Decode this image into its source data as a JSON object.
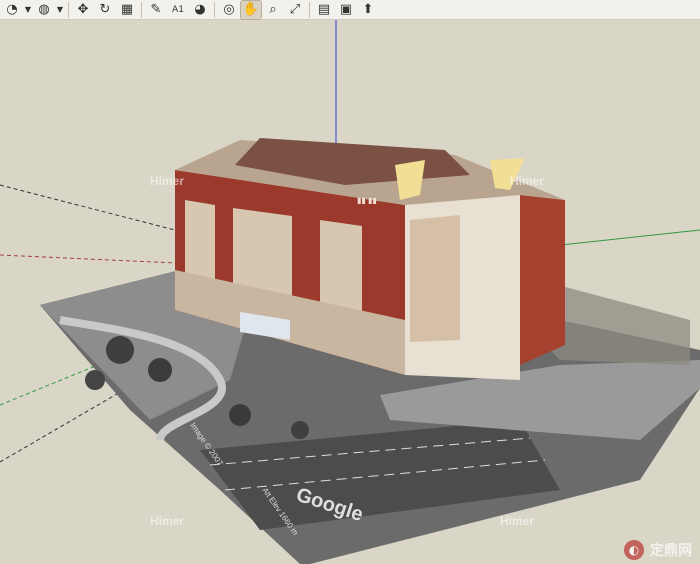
{
  "toolbar": {
    "items": [
      {
        "name": "arc-icon",
        "glyph": "◔"
      },
      {
        "name": "offset-icon",
        "glyph": "◍"
      },
      {
        "name": "move-icon",
        "glyph": "✥"
      },
      {
        "name": "rotate-icon",
        "glyph": "↻"
      },
      {
        "name": "push-pull-icon",
        "glyph": "▦"
      },
      {
        "name": "tape-measure-icon",
        "glyph": "✎"
      },
      {
        "name": "text-icon",
        "glyph": "A1"
      },
      {
        "name": "paint-bucket-icon",
        "glyph": "◕"
      },
      {
        "name": "orbit-icon",
        "glyph": "◎"
      },
      {
        "name": "pan-icon",
        "glyph": "✋"
      },
      {
        "name": "zoom-icon",
        "glyph": "⌕"
      },
      {
        "name": "zoom-extents-icon",
        "glyph": "⤢"
      },
      {
        "name": "components-icon",
        "glyph": "▤"
      },
      {
        "name": "materials-icon",
        "glyph": "▣"
      },
      {
        "name": "get-models-icon",
        "glyph": "⬆"
      }
    ]
  },
  "viewport": {
    "watermarks": [
      "Himer",
      "Himer",
      "Himer",
      "Himer"
    ],
    "map_brand": "Google",
    "map_note_1": "Image © 2007",
    "map_note_2": "Alt Elev 1660 m",
    "site_logo_text": "定鼎网"
  },
  "colors": {
    "sky": "#d9d5c7",
    "brick": "#9b3a2c",
    "roof": "#7a5142",
    "cream": "#e8e0d2"
  }
}
